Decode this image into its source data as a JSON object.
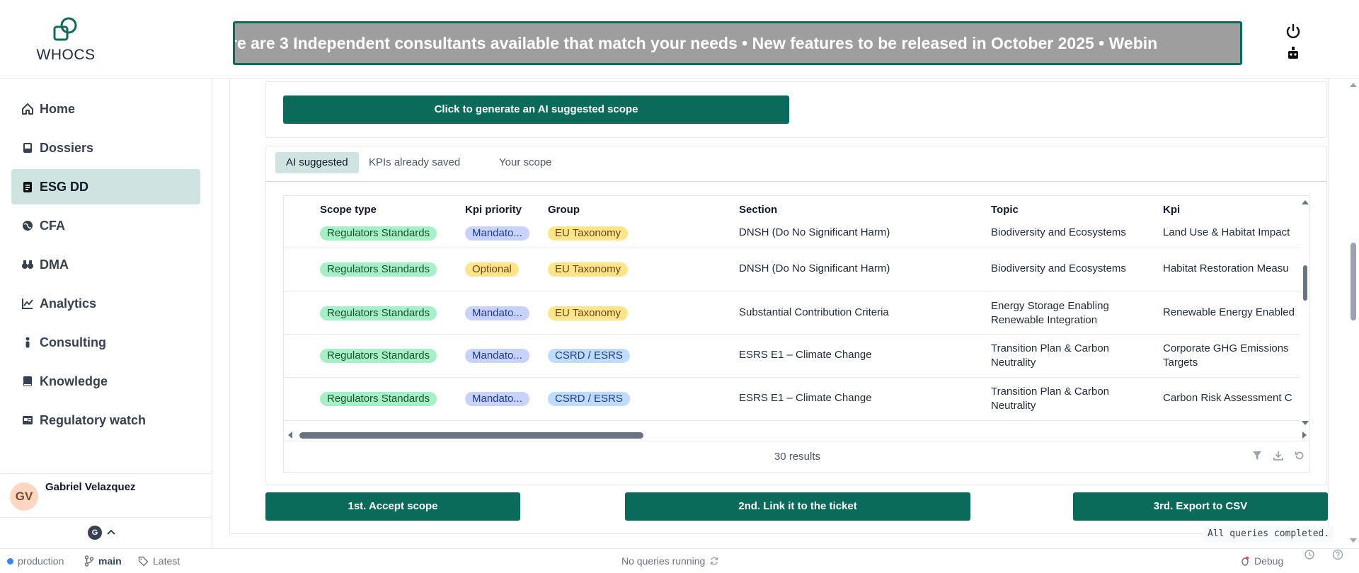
{
  "app": {
    "logo_text": "WHOCS",
    "ticker": "re are 3 Independent consultants available that match your needs    •    New features to be released in October 2025 • Webin"
  },
  "sidebar": {
    "items": [
      {
        "label": "Home",
        "icon": "home-icon"
      },
      {
        "label": "Dossiers",
        "icon": "inbox-icon"
      },
      {
        "label": "ESG DD",
        "icon": "clipboard-icon"
      },
      {
        "label": "CFA",
        "icon": "globe-icon"
      },
      {
        "label": "DMA",
        "icon": "binoculars-icon"
      },
      {
        "label": "Analytics",
        "icon": "chart-line-icon"
      },
      {
        "label": "Consulting",
        "icon": "person-icon"
      },
      {
        "label": "Knowledge",
        "icon": "book-icon"
      },
      {
        "label": "Regulatory watch",
        "icon": "newspaper-icon"
      }
    ],
    "active_index": 2,
    "user": {
      "initials": "GV",
      "name": "Gabriel Velazquez"
    },
    "footer_badge": "G"
  },
  "main": {
    "generate_button": "Click to generate an AI suggested scope",
    "tabs": [
      {
        "label": "AI suggested",
        "active": true
      },
      {
        "label": "KPIs already saved",
        "active": false
      },
      {
        "label": "Your scope",
        "active": false
      }
    ],
    "table": {
      "columns": [
        "Scope type",
        "Kpi priority",
        "Group",
        "Section",
        "Topic",
        "Kpi"
      ],
      "rows": [
        {
          "scope": "Regulators Standards",
          "priority": "Mandato...",
          "priority_color": "blue",
          "group": "EU Taxonomy",
          "group_color": "yellow",
          "section": "DNSH (Do No Significant Harm)",
          "topic": "Biodiversity and Ecosystems",
          "kpi": "Land Use & Habitat Impact"
        },
        {
          "scope": "Regulators Standards",
          "priority": "Optional",
          "priority_color": "yellow",
          "group": "EU Taxonomy",
          "group_color": "yellow",
          "section": "DNSH (Do No Significant Harm)",
          "topic": "Biodiversity and Ecosystems",
          "kpi": "Habitat Restoration Measu"
        },
        {
          "scope": "Regulators Standards",
          "priority": "Mandato...",
          "priority_color": "blue",
          "group": "EU Taxonomy",
          "group_color": "yellow",
          "section": "Substantial Contribution Criteria",
          "topic": "Energy Storage Enabling Renewable Integration",
          "kpi": "Renewable Energy Enabled"
        },
        {
          "scope": "Regulators Standards",
          "priority": "Mandato...",
          "priority_color": "blue",
          "group": "CSRD / ESRS",
          "group_color": "lblue",
          "section": "ESRS E1 – Climate Change",
          "topic": "Transition Plan & Carbon Neutrality",
          "kpi": "Corporate GHG Emissions Targets"
        },
        {
          "scope": "Regulators Standards",
          "priority": "Mandato...",
          "priority_color": "blue",
          "group": "CSRD / ESRS",
          "group_color": "lblue",
          "section": "ESRS E1 – Climate Change",
          "topic": "Transition Plan & Carbon Neutrality",
          "kpi": "Carbon Risk Assessment C"
        }
      ],
      "results": "30 results"
    },
    "buttons": {
      "accept": "1st. Accept scope",
      "link": "2nd. Link it to the ticket",
      "export": "3rd. Export to CSV"
    },
    "queries_status": "All queries completed."
  },
  "statusbar": {
    "env": "production",
    "branch": "main",
    "tag": "Latest",
    "queries": "No queries running",
    "debug": "Debug"
  },
  "colors": {
    "accent": "#0b6b5a",
    "active_bg": "#cfe3e0"
  }
}
